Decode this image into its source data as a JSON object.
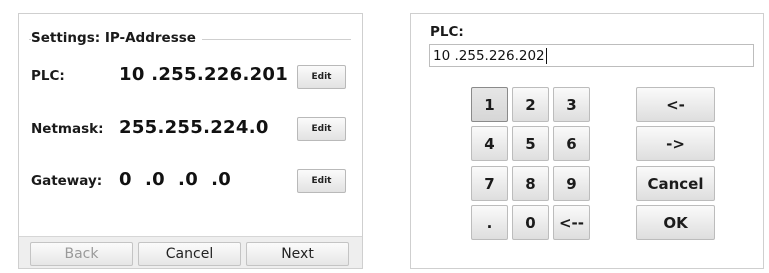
{
  "settings": {
    "title": "Settings: IP-Addresse",
    "rows": [
      {
        "label": "PLC:",
        "value": "10 .255.226.201",
        "edit": "Edit"
      },
      {
        "label": "Netmask:",
        "value": "255.255.224.0",
        "edit": "Edit"
      },
      {
        "label": "Gateway:",
        "value": "0  .0  .0  .0",
        "edit": "Edit"
      }
    ],
    "buttons": {
      "back": "Back",
      "cancel": "Cancel",
      "next": "Next"
    }
  },
  "keypad": {
    "label": "PLC:",
    "value": "10 .255.226.202",
    "keys": {
      "k1": "1",
      "k2": "2",
      "k3": "3",
      "k4": "4",
      "k5": "5",
      "k6": "6",
      "k7": "7",
      "k8": "8",
      "k9": "9",
      "dot": ".",
      "k0": "0",
      "backspace": "<--",
      "left": "<-",
      "right": "->",
      "cancel": "Cancel",
      "ok": "OK"
    }
  }
}
